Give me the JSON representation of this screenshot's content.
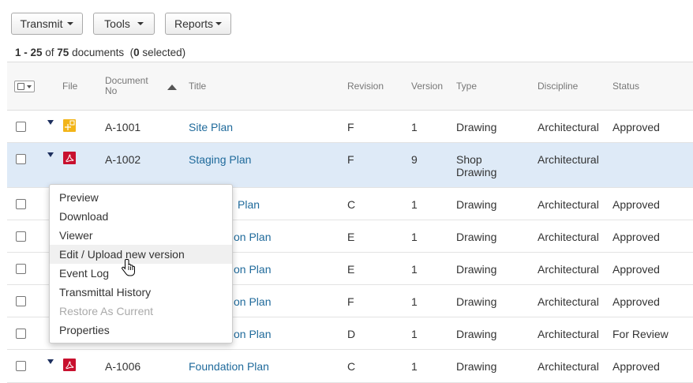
{
  "toolbar": {
    "transmit_label": "Transmit",
    "tools_label": "Tools",
    "reports_label": "Reports"
  },
  "summary": {
    "range": "1 - 25",
    "of_word": " of ",
    "total": "75",
    "documents_word": " documents  (",
    "selected_count": "0",
    "selected_word": " selected)"
  },
  "columns": {
    "file": "File",
    "document_no_line1": "Document",
    "document_no_line2": "No",
    "title": "Title",
    "revision": "Revision",
    "version": "Version",
    "type": "Type",
    "discipline": "Discipline",
    "status": "Status"
  },
  "rows": [
    {
      "doc_no": "A-1001",
      "title": "Site Plan",
      "revision": "F",
      "version": "1",
      "type": "Drawing",
      "type2": "",
      "discipline": "Architectural",
      "status": "Approved",
      "file_icon": "image-file-icon"
    },
    {
      "doc_no": "A-1002",
      "title": "Staging Plan",
      "revision": "F",
      "version": "9",
      "type": "Shop",
      "type2": "Drawing",
      "discipline": "Architectural",
      "status": "",
      "file_icon": "pdf-file-icon"
    },
    {
      "doc_no": "",
      "title": "Plan",
      "revision": "C",
      "version": "1",
      "type": "Drawing",
      "type2": "",
      "discipline": "Architectural",
      "status": "Approved",
      "file_icon": ""
    },
    {
      "doc_no": "",
      "title": "on Plan",
      "revision": "E",
      "version": "1",
      "type": "Drawing",
      "type2": "",
      "discipline": "Architectural",
      "status": "Approved",
      "file_icon": ""
    },
    {
      "doc_no": "",
      "title": "on Plan",
      "revision": "E",
      "version": "1",
      "type": "Drawing",
      "type2": "",
      "discipline": "Architectural",
      "status": "Approved",
      "file_icon": ""
    },
    {
      "doc_no": "",
      "title": "on Plan",
      "revision": "F",
      "version": "1",
      "type": "Drawing",
      "type2": "",
      "discipline": "Architectural",
      "status": "Approved",
      "file_icon": ""
    },
    {
      "doc_no": "",
      "title": "on Plan",
      "revision": "D",
      "version": "1",
      "type": "Drawing",
      "type2": "",
      "discipline": "Architectural",
      "status": "For Review",
      "file_icon": ""
    },
    {
      "doc_no": "A-1006",
      "title": "Foundation Plan",
      "revision": "C",
      "version": "1",
      "type": "Drawing",
      "type2": "",
      "discipline": "Architectural",
      "status": "Approved",
      "file_icon": "pdf-file-icon"
    }
  ],
  "context_menu": {
    "items": [
      {
        "label": "Preview",
        "state": "normal"
      },
      {
        "label": "Download",
        "state": "normal"
      },
      {
        "label": "Viewer",
        "state": "normal"
      },
      {
        "label": "Edit / Upload new version",
        "state": "hover"
      },
      {
        "label": "Event Log",
        "state": "normal"
      },
      {
        "label": "Transmittal History",
        "state": "normal"
      },
      {
        "label": "Restore As Current",
        "state": "disabled"
      },
      {
        "label": "Properties",
        "state": "normal"
      }
    ]
  },
  "colors": {
    "link": "#1f6a9b",
    "row_highlight": "#deeaf7",
    "pdf_icon": "#c8102e",
    "image_icon": "#f2b418",
    "expander": "#1d2f5e"
  }
}
